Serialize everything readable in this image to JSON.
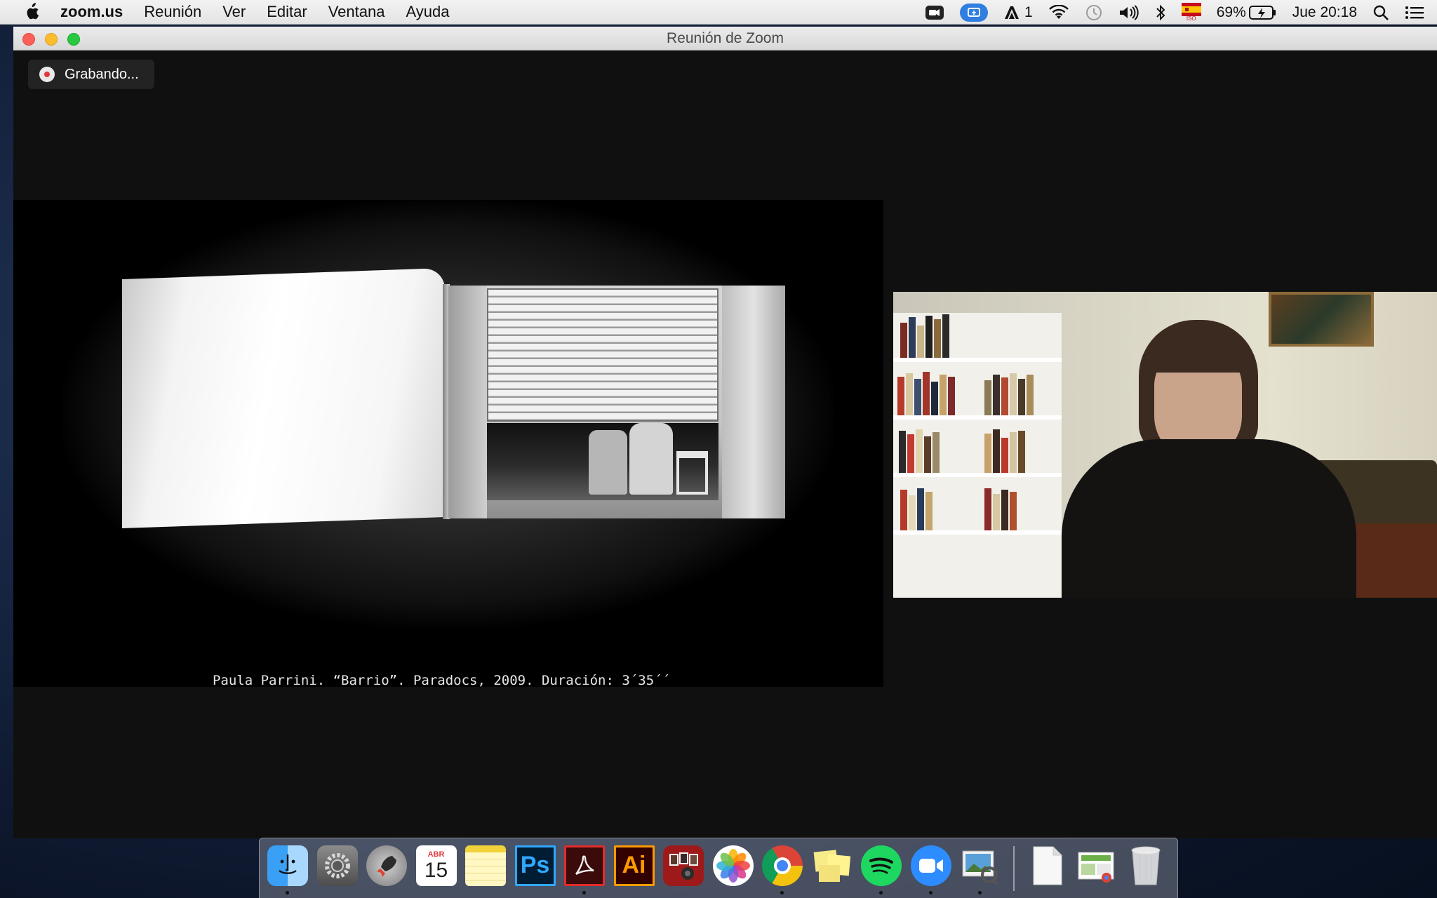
{
  "menubar": {
    "app_name": "zoom.us",
    "menus": [
      "Reunión",
      "Ver",
      "Editar",
      "Ventana",
      "Ayuda"
    ],
    "adobe_count": "1",
    "battery": "69%",
    "clock": "Jue 20:18",
    "input_source": "ISO"
  },
  "window": {
    "title": "Reunión de Zoom",
    "recording_label": "Grabando..."
  },
  "share": {
    "caption": "Paula Parrini. “Barrio”. Paradocs, 2009. Duración: 3´35´´"
  },
  "dock": {
    "items": [
      {
        "name": "finder",
        "running": true
      },
      {
        "name": "system-preferences",
        "running": false
      },
      {
        "name": "launchpad",
        "running": false
      },
      {
        "name": "calendar",
        "month": "ABR",
        "day": "15",
        "running": false
      },
      {
        "name": "notes",
        "running": false
      },
      {
        "name": "photoshop",
        "label": "Ps",
        "running": false
      },
      {
        "name": "acrobat",
        "running": true
      },
      {
        "name": "illustrator",
        "label": "Ai",
        "running": false
      },
      {
        "name": "photo-booth",
        "running": false
      },
      {
        "name": "photos",
        "running": false
      },
      {
        "name": "chrome",
        "running": true
      },
      {
        "name": "stickies",
        "running": false
      },
      {
        "name": "spotify",
        "running": true
      },
      {
        "name": "zoom",
        "running": true
      },
      {
        "name": "preview",
        "running": true
      }
    ],
    "right_items": [
      "document",
      "downloads-stack",
      "trash"
    ]
  },
  "colors": {
    "zoom_blue": "#2d8cff",
    "record_red": "#e0383b",
    "photoshop_blue": "#31a8ff",
    "acrobat_red": "#e22c2c",
    "illustrator_orange": "#ff9a00",
    "spotify_green": "#1ed760"
  }
}
